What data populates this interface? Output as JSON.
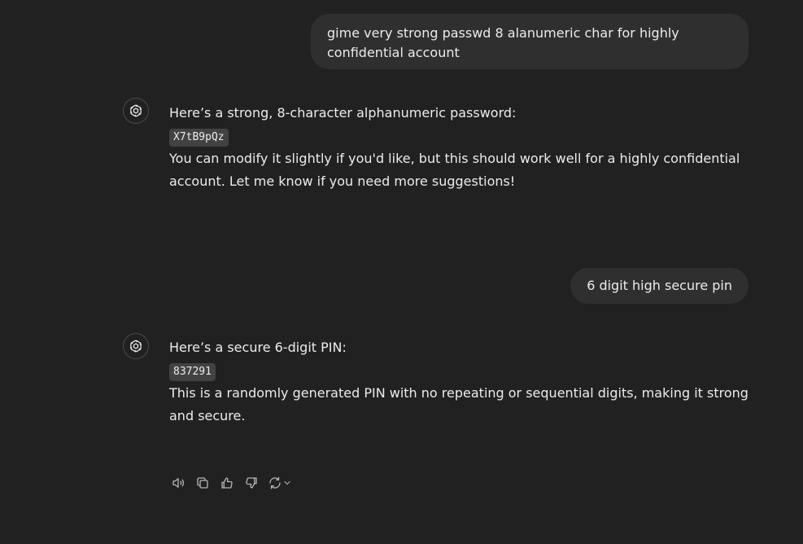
{
  "conversation": {
    "user_messages": [
      {
        "text": "gime very strong passwd  8 alanumeric char for highly confidential account"
      },
      {
        "text": "6 digit high secure pin"
      }
    ],
    "assistant_messages": [
      {
        "intro": "Here’s a strong, 8-character alphanumeric password:",
        "code": "X7tB9pQz",
        "body": "You can modify it slightly if you'd like, but this should work well for a highly confidential account. Let me know if you need more suggestions!"
      },
      {
        "intro": "Here’s a secure 6-digit PIN:",
        "code": "837291",
        "body": "This is a randomly generated PIN with no repeating or sequential digits, making it strong and secure."
      }
    ]
  },
  "message_actions": [
    {
      "icon": "speaker-icon"
    },
    {
      "icon": "copy-icon"
    },
    {
      "icon": "thumbs-up-icon"
    },
    {
      "icon": "thumbs-down-icon"
    },
    {
      "icon": "regenerate-icon"
    }
  ],
  "colors": {
    "background": "#212121",
    "user_bubble": "#2f2f2f",
    "text": "#ececec",
    "code_background": "#424242",
    "icon": "#b4b4b4"
  }
}
